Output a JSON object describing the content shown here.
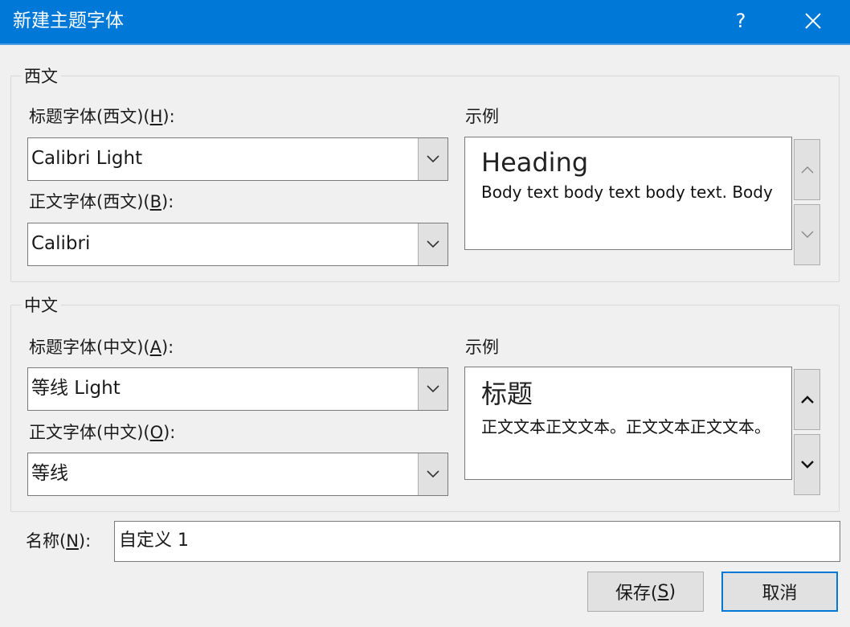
{
  "window": {
    "title": "新建主题字体",
    "help_label": "?",
    "close_label": "✕"
  },
  "western": {
    "group_label": "西文",
    "heading_font": {
      "label_prefix": "标题字体(西文)(",
      "accesskey": "H",
      "label_suffix": "):",
      "value": "Calibri Light"
    },
    "body_font": {
      "label_prefix": "正文字体(西文)(",
      "accesskey": "B",
      "label_suffix": "):",
      "value": "Calibri"
    },
    "preview": {
      "label": "示例",
      "heading": "Heading",
      "body": "Body text body text body text. Body text body text."
    }
  },
  "chinese": {
    "group_label": "中文",
    "heading_font": {
      "label_prefix": "标题字体(中文)(",
      "accesskey": "A",
      "label_suffix": "):",
      "value": "等线 Light"
    },
    "body_font": {
      "label_prefix": "正文字体(中文)(",
      "accesskey": "O",
      "label_suffix": "):",
      "value": "等线"
    },
    "preview": {
      "label": "示例",
      "heading": "标题",
      "body": "正文文本正文文本。正文文本正文文本。"
    }
  },
  "name_field": {
    "label_prefix": "名称(",
    "accesskey": "N",
    "label_suffix": "):",
    "value": "自定义 1"
  },
  "buttons": {
    "save_prefix": "保存(",
    "save_accesskey": "S",
    "save_suffix": ")",
    "cancel": "取消"
  },
  "colors": {
    "titlebar": "#0078d7",
    "default_button_border": "#0078d7",
    "dialog_bg": "#f0f0f0"
  }
}
